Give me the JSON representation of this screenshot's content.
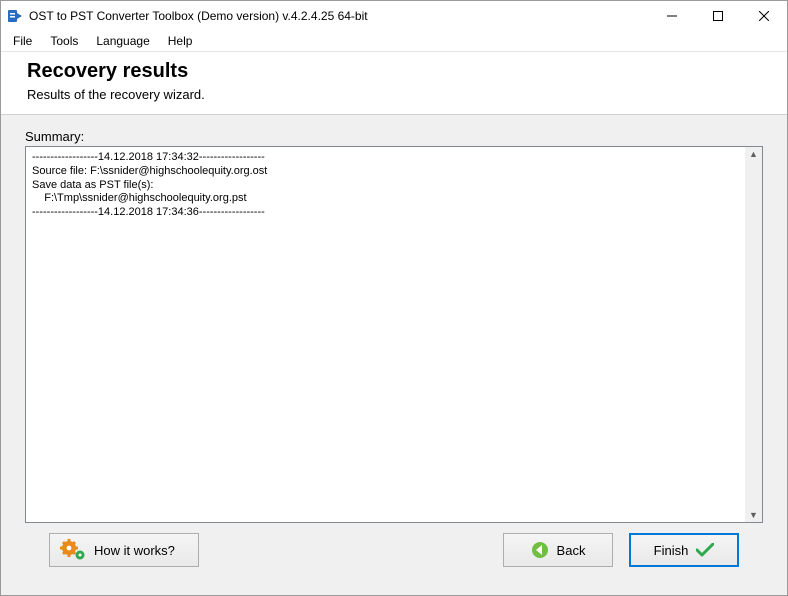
{
  "window": {
    "title": "OST to PST Converter Toolbox (Demo version) v.4.2.4.25 64-bit"
  },
  "menu": {
    "file": "File",
    "tools": "Tools",
    "language": "Language",
    "help": "Help"
  },
  "header": {
    "title": "Recovery results",
    "subtitle": "Results of the recovery wizard."
  },
  "summary": {
    "label": "Summary:",
    "log": "------------------14.12.2018 17:34:32------------------\nSource file: F:\\ssnider@highschoolequity.org.ost\nSave data as PST file(s):\n    F:\\Tmp\\ssnider@highschoolequity.org.pst\n------------------14.12.2018 17:34:36------------------"
  },
  "buttons": {
    "how": "How it works?",
    "back": "Back",
    "finish": "Finish"
  }
}
